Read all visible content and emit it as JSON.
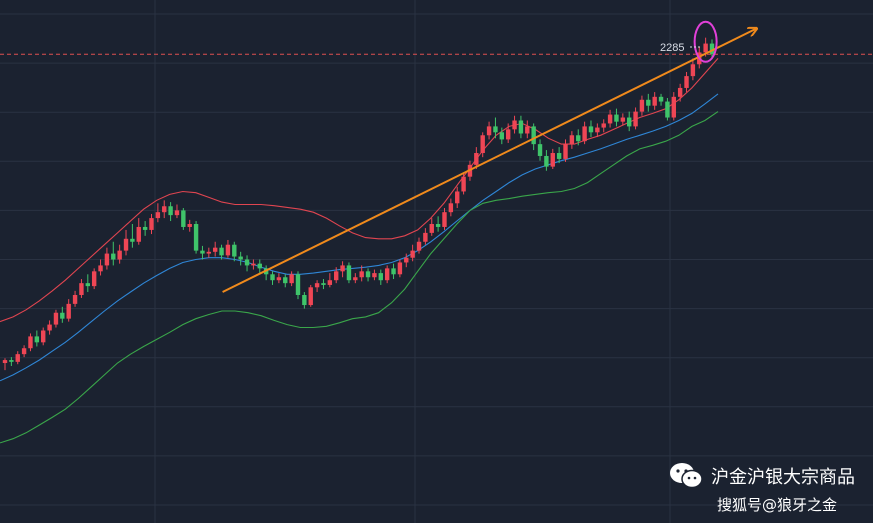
{
  "chart_data": {
    "type": "candlestick",
    "price_label": "2285",
    "ylim": [
      1500,
      2330
    ],
    "colors": {
      "background": "#1b2230",
      "grid": "#2a3242",
      "up": "#ef4655",
      "down": "#3fc46a",
      "upper_band": "#e04550",
      "middle_band": "#2f86d6",
      "lower_band": "#3aa64a",
      "trendline": "#f08a1c",
      "highlight_ellipse": "#e040d8",
      "dashed_price_line": "#e05050"
    },
    "candles": [
      [
        1740,
        1745,
        1728,
        1748
      ],
      [
        1745,
        1742,
        1735,
        1750
      ],
      [
        1742,
        1755,
        1738,
        1760
      ],
      [
        1755,
        1765,
        1750,
        1770
      ],
      [
        1765,
        1785,
        1760,
        1790
      ],
      [
        1785,
        1775,
        1768,
        1795
      ],
      [
        1775,
        1795,
        1770,
        1800
      ],
      [
        1795,
        1805,
        1788,
        1812
      ],
      [
        1805,
        1825,
        1800,
        1830
      ],
      [
        1825,
        1815,
        1808,
        1835
      ],
      [
        1815,
        1840,
        1810,
        1848
      ],
      [
        1840,
        1855,
        1835,
        1862
      ],
      [
        1855,
        1875,
        1850,
        1882
      ],
      [
        1875,
        1870,
        1860,
        1890
      ],
      [
        1870,
        1895,
        1865,
        1900
      ],
      [
        1895,
        1905,
        1888,
        1915
      ],
      [
        1905,
        1925,
        1898,
        1935
      ],
      [
        1925,
        1915,
        1905,
        1945
      ],
      [
        1915,
        1930,
        1908,
        1940
      ],
      [
        1930,
        1950,
        1922,
        1965
      ],
      [
        1950,
        1945,
        1935,
        1975
      ],
      [
        1945,
        1970,
        1940,
        1985
      ],
      [
        1970,
        1965,
        1955,
        1980
      ],
      [
        1965,
        1985,
        1958,
        1992
      ],
      [
        1985,
        1995,
        1978,
        2010
      ],
      [
        1995,
        2005,
        1985,
        2015
      ],
      [
        2005,
        1990,
        1980,
        2012
      ],
      [
        1990,
        1998,
        1985,
        2008
      ],
      [
        1998,
        1970,
        1965,
        2002
      ],
      [
        1970,
        1975,
        1962,
        1982
      ],
      [
        1975,
        1930,
        1925,
        1980
      ],
      [
        1930,
        1925,
        1915,
        1938
      ],
      [
        1925,
        1928,
        1918,
        1935
      ],
      [
        1928,
        1935,
        1920,
        1945
      ],
      [
        1935,
        1922,
        1915,
        1940
      ],
      [
        1922,
        1940,
        1918,
        1948
      ],
      [
        1940,
        1920,
        1912,
        1945
      ],
      [
        1920,
        1915,
        1905,
        1928
      ],
      [
        1915,
        1905,
        1895,
        1922
      ],
      [
        1905,
        1908,
        1898,
        1915
      ],
      [
        1908,
        1900,
        1890,
        1915
      ],
      [
        1900,
        1890,
        1880,
        1905
      ],
      [
        1890,
        1880,
        1872,
        1895
      ],
      [
        1880,
        1885,
        1875,
        1892
      ],
      [
        1885,
        1875,
        1868,
        1890
      ],
      [
        1875,
        1890,
        1870,
        1895
      ],
      [
        1890,
        1855,
        1848,
        1895
      ],
      [
        1855,
        1838,
        1832,
        1860
      ],
      [
        1838,
        1868,
        1835,
        1872
      ],
      [
        1868,
        1875,
        1860,
        1880
      ],
      [
        1875,
        1872,
        1865,
        1882
      ],
      [
        1872,
        1880,
        1868,
        1892
      ],
      [
        1880,
        1895,
        1875,
        1902
      ],
      [
        1895,
        1905,
        1885,
        1912
      ],
      [
        1905,
        1880,
        1875,
        1910
      ],
      [
        1880,
        1885,
        1875,
        1892
      ],
      [
        1885,
        1895,
        1878,
        1905
      ],
      [
        1895,
        1885,
        1878,
        1900
      ],
      [
        1885,
        1892,
        1880,
        1898
      ],
      [
        1892,
        1880,
        1872,
        1898
      ],
      [
        1880,
        1900,
        1875,
        1905
      ],
      [
        1900,
        1890,
        1882,
        1908
      ],
      [
        1890,
        1910,
        1885,
        1915
      ],
      [
        1910,
        1918,
        1902,
        1925
      ],
      [
        1918,
        1930,
        1912,
        1940
      ],
      [
        1930,
        1945,
        1925,
        1952
      ],
      [
        1945,
        1960,
        1940,
        1968
      ],
      [
        1960,
        1975,
        1955,
        1985
      ],
      [
        1975,
        1970,
        1962,
        1988
      ],
      [
        1970,
        1995,
        1965,
        2002
      ],
      [
        1995,
        2010,
        1988,
        2018
      ],
      [
        2010,
        2030,
        2002,
        2038
      ],
      [
        2030,
        2055,
        2025,
        2062
      ],
      [
        2055,
        2075,
        2048,
        2082
      ],
      [
        2075,
        2095,
        2068,
        2105
      ],
      [
        2095,
        2125,
        2088,
        2130
      ],
      [
        2125,
        2140,
        2118,
        2148
      ],
      [
        2140,
        2130,
        2120,
        2155
      ],
      [
        2130,
        2118,
        2110,
        2138
      ],
      [
        2118,
        2135,
        2112,
        2145
      ],
      [
        2135,
        2150,
        2128,
        2158
      ],
      [
        2150,
        2128,
        2120,
        2158
      ],
      [
        2128,
        2140,
        2120,
        2150
      ],
      [
        2140,
        2110,
        2100,
        2145
      ],
      [
        2110,
        2090,
        2082,
        2118
      ],
      [
        2090,
        2072,
        2065,
        2100
      ],
      [
        2072,
        2095,
        2068,
        2102
      ],
      [
        2095,
        2085,
        2078,
        2105
      ],
      [
        2085,
        2110,
        2080,
        2118
      ],
      [
        2110,
        2125,
        2102,
        2132
      ],
      [
        2125,
        2115,
        2108,
        2135
      ],
      [
        2115,
        2140,
        2110,
        2148
      ],
      [
        2140,
        2130,
        2122,
        2150
      ],
      [
        2130,
        2138,
        2122,
        2145
      ],
      [
        2138,
        2145,
        2130,
        2152
      ],
      [
        2145,
        2160,
        2138,
        2168
      ],
      [
        2160,
        2148,
        2140,
        2170
      ],
      [
        2148,
        2155,
        2142,
        2162
      ],
      [
        2155,
        2140,
        2132,
        2165
      ],
      [
        2140,
        2165,
        2135,
        2172
      ],
      [
        2165,
        2185,
        2158,
        2192
      ],
      [
        2185,
        2175,
        2165,
        2195
      ],
      [
        2175,
        2190,
        2168,
        2198
      ],
      [
        2190,
        2182,
        2175,
        2195
      ],
      [
        2182,
        2155,
        2150,
        2188
      ],
      [
        2155,
        2190,
        2150,
        2198
      ],
      [
        2190,
        2205,
        2182,
        2212
      ],
      [
        2205,
        2225,
        2198,
        2232
      ],
      [
        2225,
        2245,
        2218,
        2255
      ],
      [
        2245,
        2265,
        2238,
        2275
      ],
      [
        2265,
        2280,
        2258,
        2290
      ],
      [
        2280,
        2262,
        2255,
        2287
      ]
    ],
    "bands": {
      "upper": [
        1810,
        1818,
        1830,
        1845,
        1862,
        1880,
        1900,
        1920,
        1940,
        1960,
        1980,
        2000,
        2015,
        2025,
        2030,
        2028,
        2020,
        2012,
        2008,
        2008,
        2008,
        2006,
        2003,
        2000,
        1995,
        1985,
        1972,
        1960,
        1952,
        1950,
        1950,
        1955,
        1965,
        1985,
        2010,
        2040,
        2070,
        2100,
        2125,
        2140,
        2145,
        2135,
        2120,
        2110,
        2110,
        2118,
        2125,
        2135,
        2145,
        2155,
        2162,
        2170,
        2185,
        2205,
        2230,
        2255
      ],
      "middle": [
        1710,
        1720,
        1732,
        1745,
        1760,
        1775,
        1792,
        1810,
        1828,
        1845,
        1860,
        1875,
        1888,
        1900,
        1910,
        1915,
        1918,
        1918,
        1915,
        1910,
        1902,
        1895,
        1890,
        1890,
        1892,
        1895,
        1898,
        1900,
        1902,
        1905,
        1910,
        1918,
        1930,
        1945,
        1962,
        1980,
        1998,
        2015,
        2030,
        2045,
        2058,
        2068,
        2075,
        2082,
        2088,
        2095,
        2102,
        2110,
        2118,
        2125,
        2132,
        2140,
        2150,
        2162,
        2178,
        2195
      ],
      "lower": [
        1605,
        1612,
        1622,
        1635,
        1648,
        1662,
        1680,
        1700,
        1720,
        1740,
        1755,
        1768,
        1780,
        1792,
        1805,
        1815,
        1822,
        1828,
        1828,
        1825,
        1820,
        1812,
        1805,
        1800,
        1800,
        1802,
        1808,
        1815,
        1818,
        1825,
        1842,
        1865,
        1895,
        1925,
        1950,
        1975,
        1998,
        2010,
        2015,
        2018,
        2022,
        2025,
        2028,
        2030,
        2035,
        2045,
        2060,
        2075,
        2090,
        2102,
        2108,
        2115,
        2125,
        2140,
        2150,
        2165
      ]
    },
    "trendline": {
      "from": [
        0.265,
        1860
      ],
      "to": [
        0.9,
        2305
      ]
    }
  },
  "footer": {
    "account": "沪金沪银大宗商品",
    "source": "搜狐号@狼牙之金"
  }
}
